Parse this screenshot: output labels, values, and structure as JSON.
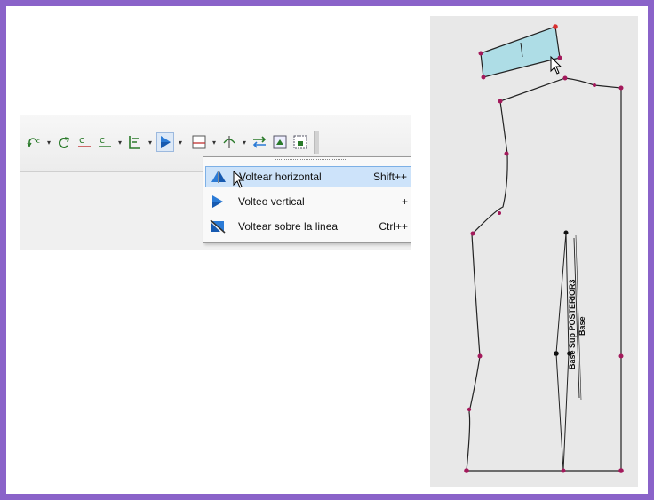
{
  "toolbar": {
    "icons": [
      "rotate-ccw-icon",
      "rotate-cw-icon",
      "align-horizontal-icon",
      "align-arc-icon",
      "align-step-icon",
      "flip-icon",
      "page-icon",
      "mirror-icon",
      "swap-icon",
      "image-icon",
      "image-dotted-icon"
    ]
  },
  "flip_menu": {
    "items": [
      {
        "label": "Voltear horizontal",
        "shortcut": "Shift++"
      },
      {
        "label": "Volteo vertical",
        "shortcut": "+"
      },
      {
        "label": "Voltear sobre la linea",
        "shortcut": "Ctrl++"
      }
    ]
  },
  "pattern": {
    "piece_label": "Base Sup POSTERIOR3",
    "piece_sub_label": "Base",
    "collar_label": "I",
    "point_color": "#a3195b",
    "collar_fill": "#aedde6"
  }
}
